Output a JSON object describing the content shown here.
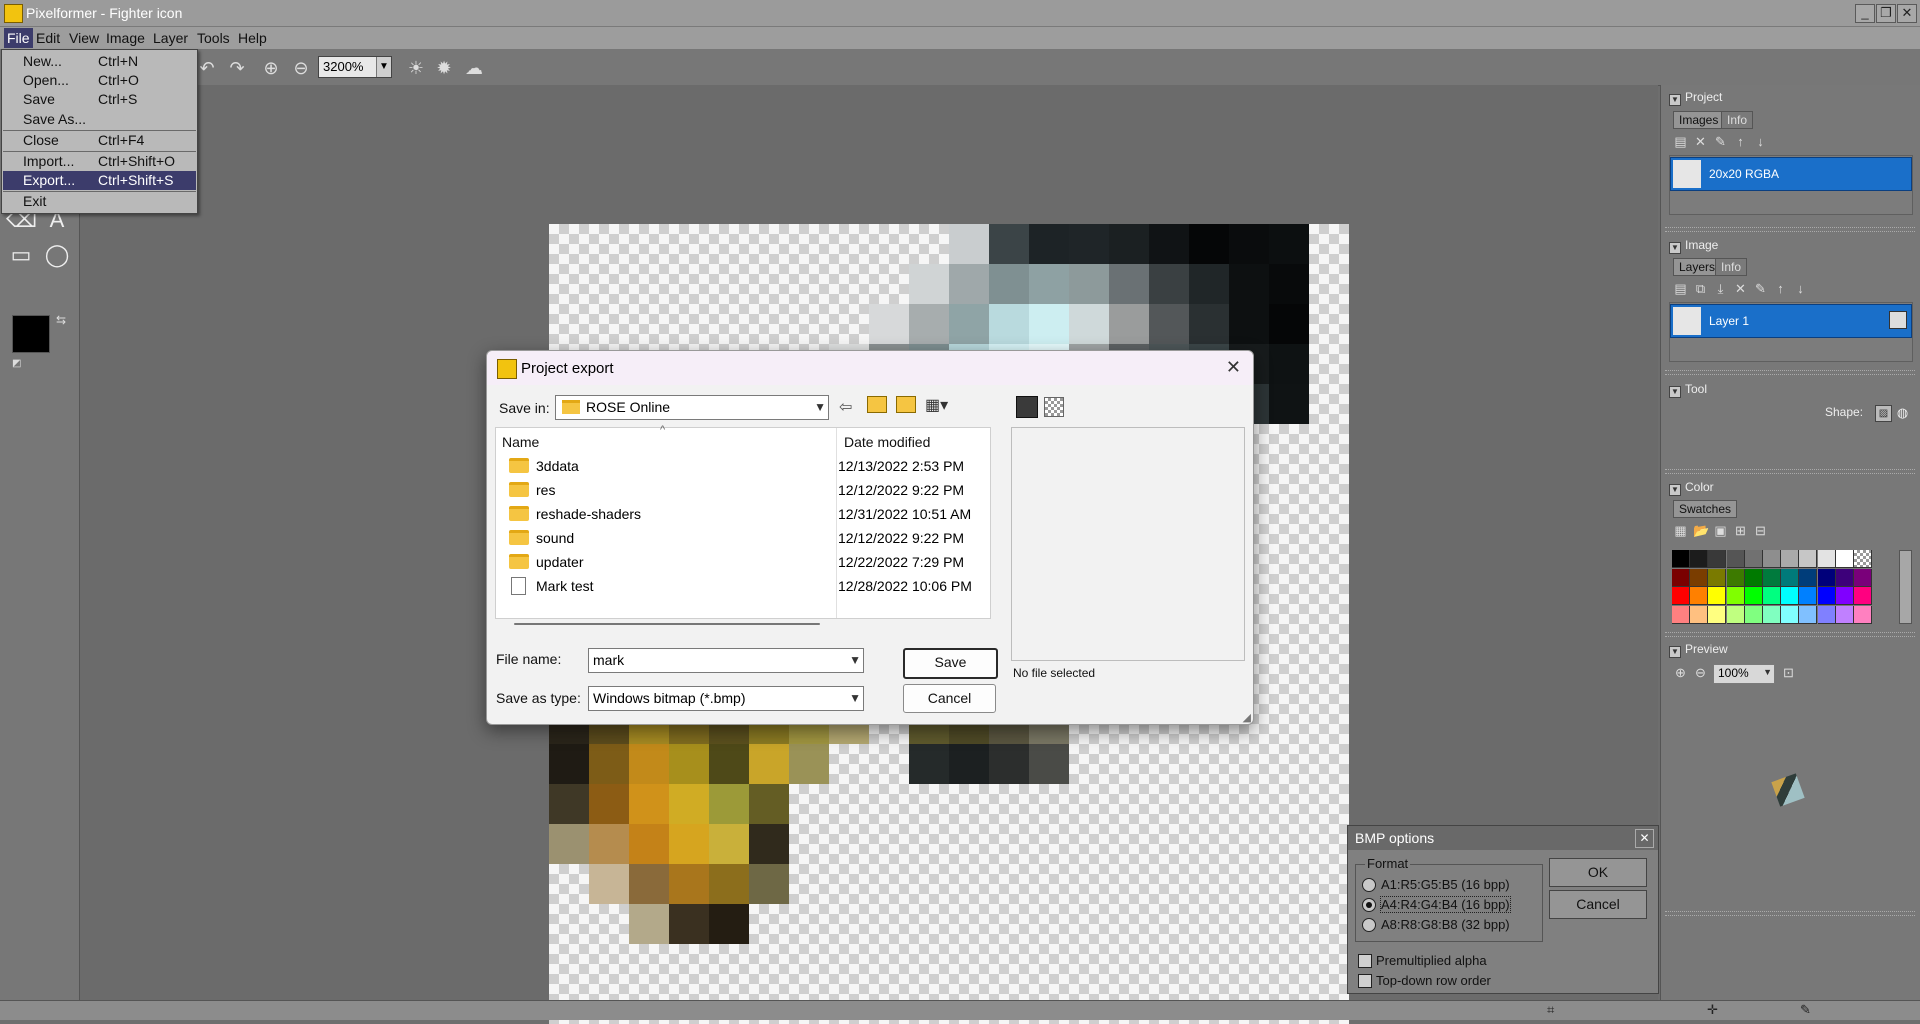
{
  "window": {
    "title": "Pixelformer - Fighter icon"
  },
  "menubar": {
    "items": [
      "File",
      "Edit",
      "View",
      "Image",
      "Layer",
      "Tools",
      "Help"
    ]
  },
  "toolbar": {
    "zoom": "3200%"
  },
  "file_menu": {
    "items": [
      {
        "label": "New...",
        "shortcut": "Ctrl+N"
      },
      {
        "label": "Open...",
        "shortcut": "Ctrl+O"
      },
      {
        "label": "Save",
        "shortcut": "Ctrl+S"
      },
      {
        "label": "Save As...",
        "shortcut": ""
      },
      {
        "label": "Close",
        "shortcut": "Ctrl+F4"
      },
      {
        "label": "Import...",
        "shortcut": "Ctrl+Shift+O"
      },
      {
        "label": "Export...",
        "shortcut": "Ctrl+Shift+S"
      },
      {
        "label": "Exit",
        "shortcut": ""
      }
    ],
    "highlighted": "Export..."
  },
  "right_panel": {
    "project": {
      "title": "Project",
      "tabs": [
        "Images",
        "Info"
      ],
      "item": "20x20 RGBA"
    },
    "image": {
      "title": "Image",
      "tabs": [
        "Layers",
        "Info"
      ],
      "item": "Layer 1"
    },
    "tool": {
      "title": "Tool",
      "shape_label": "Shape:"
    },
    "color": {
      "title": "Color",
      "tabs": [
        "Swatches"
      ]
    },
    "preview": {
      "title": "Preview",
      "zoom": "100%"
    }
  },
  "export_dialog": {
    "title": "Project export",
    "save_in_label": "Save in:",
    "save_in_value": "ROSE Online",
    "columns": [
      "Name",
      "Date modified"
    ],
    "files": [
      {
        "name": "3ddata",
        "date": "12/13/2022 2:53 PM",
        "type": "folder"
      },
      {
        "name": "res",
        "date": "12/12/2022 9:22 PM",
        "type": "folder"
      },
      {
        "name": "reshade-shaders",
        "date": "12/31/2022 10:51 AM",
        "type": "folder"
      },
      {
        "name": "sound",
        "date": "12/12/2022 9:22 PM",
        "type": "folder"
      },
      {
        "name": "updater",
        "date": "12/22/2022 7:29 PM",
        "type": "folder"
      },
      {
        "name": "Mark test",
        "date": "12/28/2022 10:06 PM",
        "type": "file"
      }
    ],
    "preview_text": "No file selected",
    "file_name_label": "File name:",
    "file_name_value": "mark",
    "save_type_label": "Save as type:",
    "save_type_value": "Windows bitmap (*.bmp)",
    "save_button": "Save",
    "cancel_button": "Cancel"
  },
  "bmp_options": {
    "title": "BMP options",
    "format_label": "Format",
    "formats": [
      "A1:R5:G5:B5 (16 bpp)",
      "A4:R4:G4:B4 (16 bpp)",
      "A8:R8:G8:B8 (32 bpp)"
    ],
    "selected_format": "A4:R4:G4:B4 (16 bpp)",
    "premultiplied_label": "Premultiplied alpha",
    "topdown_label": "Top-down row order",
    "ok_button": "OK",
    "cancel_button": "Cancel"
  },
  "colors": {
    "selection": "#1a6fc9",
    "menu_highlight": "#3c3c6b",
    "primary_color": "#000000"
  }
}
